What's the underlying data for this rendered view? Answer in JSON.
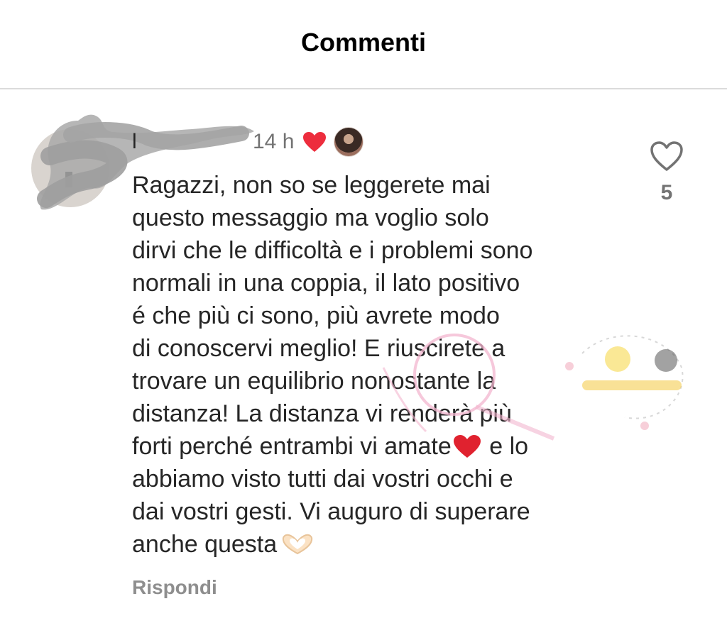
{
  "header": {
    "title": "Commenti"
  },
  "comment": {
    "username": "l",
    "timestamp": "14 h",
    "text_part1": "Ragazzi, non so se leggerete mai\nquesto messaggio ma voglio solo\ndirvi che le difficoltà e i problemi sono\nnormali in una coppia, il lato positivo\né che più ci sono, più avrete modo\ndi conoscervi meglio! E riuscirete a\ntrovare un equilibrio nonostante la\ndistanza! La distanza vi renderà più\nforti perché entrambi vi amate",
    "text_part2": " e lo\nabbiamo visto tutti dai vostri occhi e\ndai vostri gesti. Vi auguro di superare\nanche questa",
    "reply_label": "Rispondi",
    "like_count": "5"
  },
  "colors": {
    "heart_red": "#ed2d3d",
    "secondary_text": "#737373",
    "divider": "#dbdbdb"
  },
  "icons": {
    "creator_heart": "heart-filled-icon",
    "like": "heart-outline-icon",
    "inline_emoji_heart": "red-heart-emoji",
    "inline_emoji_hands": "heart-hands-emoji"
  }
}
